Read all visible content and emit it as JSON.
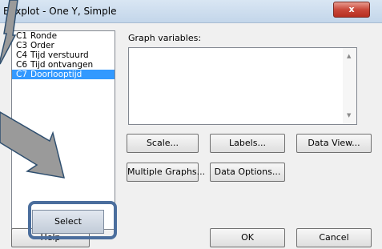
{
  "window": {
    "title": "Boxplot - One Y, Simple",
    "close_label": "x"
  },
  "column_list": [
    {
      "col": "C1",
      "name": "Ronde",
      "selected": false
    },
    {
      "col": "C3",
      "name": "Order",
      "selected": false
    },
    {
      "col": "C4",
      "name": "Tijd verstuurd",
      "selected": false
    },
    {
      "col": "C6",
      "name": "Tijd ontvangen",
      "selected": false
    },
    {
      "col": "C7",
      "name": "Doorlooptijd",
      "selected": true
    }
  ],
  "graph_variables": {
    "label": "Graph variables:",
    "value": ""
  },
  "buttons": {
    "scale": "Scale...",
    "labels": "Labels...",
    "data_view": "Data View...",
    "multiple_graphs": "Multiple Graphs...",
    "data_options": "Data Options...",
    "select": "Select",
    "help": "Help",
    "ok": "OK",
    "cancel": "Cancel"
  },
  "colors": {
    "annotation_arrow": "#9a9a9a",
    "highlight": "#4b6e9d",
    "selection": "#3399ff"
  }
}
